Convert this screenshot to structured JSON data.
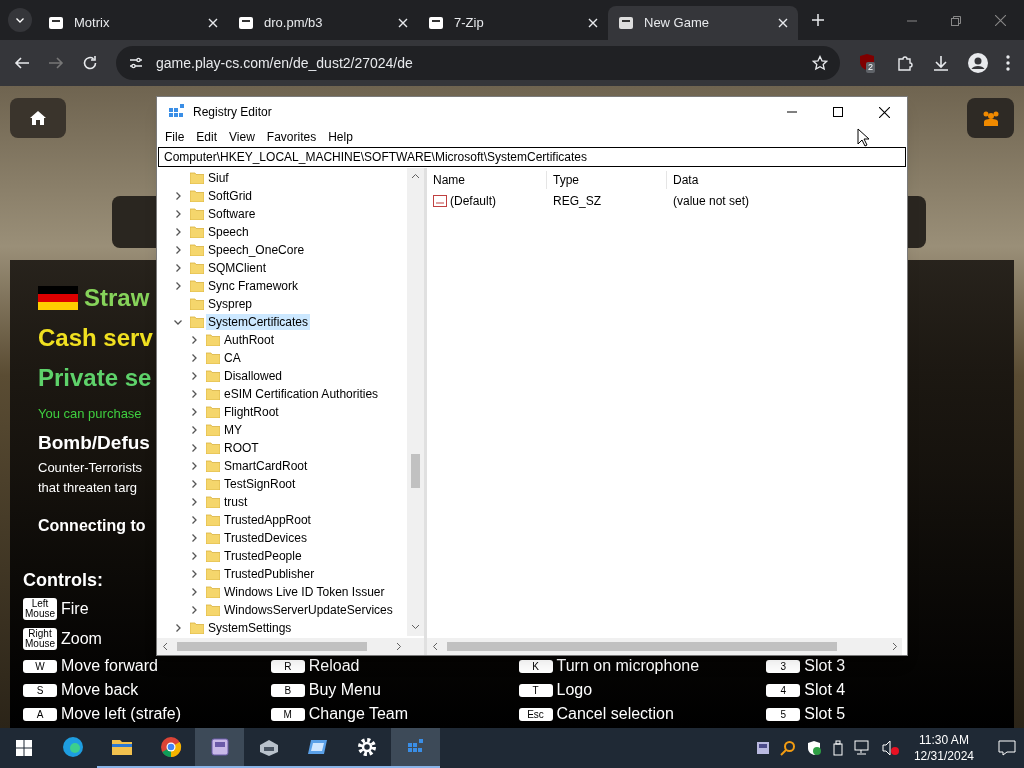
{
  "browser": {
    "tabs": [
      {
        "title": "Motrix",
        "selected": false
      },
      {
        "title": "dro.pm/b3",
        "selected": false
      },
      {
        "title": "7-Zip",
        "selected": false
      },
      {
        "title": "New Game",
        "selected": true
      }
    ],
    "url": "game.play-cs.com/en/de_dust2/27024/de",
    "extension_badge": "2"
  },
  "page": {
    "server_name": "Straw",
    "cash_line": "Cash serv",
    "private_line": "Private se",
    "purchase_note": "You can purchase",
    "mode_title": "Bomb/Defus",
    "mode_text": [
      "Counter-Terrorists",
      "that threaten targ"
    ],
    "status": "Connecting to",
    "controls_title": "Controls:",
    "controls": [
      [
        {
          "key": "Left Mouse",
          "action": "Fire"
        },
        {
          "key": "Right Mouse",
          "action": "Zoom"
        },
        {
          "key": "W",
          "action": "Move forward"
        },
        {
          "key": "S",
          "action": "Move back"
        },
        {
          "key": "A",
          "action": "Move left (strafe)"
        }
      ],
      [
        {
          "key": "R",
          "action": "Reload"
        },
        {
          "key": "B",
          "action": "Buy Menu"
        },
        {
          "key": "M",
          "action": "Change Team"
        }
      ],
      [
        {
          "key": "K",
          "action": "Turn on microphone"
        },
        {
          "key": "T",
          "action": "Logo"
        },
        {
          "key": "Esc",
          "action": "Cancel selection"
        }
      ],
      [
        {
          "key": "3",
          "action": "Slot 3"
        },
        {
          "key": "4",
          "action": "Slot 4"
        },
        {
          "key": "5",
          "action": "Slot 5"
        }
      ]
    ]
  },
  "registry": {
    "title": "Registry Editor",
    "menu": [
      "File",
      "Edit",
      "View",
      "Favorites",
      "Help"
    ],
    "address": "Computer\\HKEY_LOCAL_MACHINE\\SOFTWARE\\Microsoft\\SystemCertificates",
    "tree": [
      {
        "label": "Siuf",
        "expandable": false,
        "expanded": false,
        "selected": false
      },
      {
        "label": "SoftGrid",
        "expandable": true,
        "expanded": false,
        "selected": false
      },
      {
        "label": "Software",
        "expandable": true,
        "expanded": false,
        "selected": false
      },
      {
        "label": "Speech",
        "expandable": true,
        "expanded": false,
        "selected": false
      },
      {
        "label": "Speech_OneCore",
        "expandable": true,
        "expanded": false,
        "selected": false
      },
      {
        "label": "SQMClient",
        "expandable": true,
        "expanded": false,
        "selected": false
      },
      {
        "label": "Sync Framework",
        "expandable": true,
        "expanded": false,
        "selected": false
      },
      {
        "label": "Sysprep",
        "expandable": false,
        "expanded": false,
        "selected": false
      },
      {
        "label": "SystemCertificates",
        "expandable": true,
        "expanded": true,
        "selected": true,
        "children": [
          {
            "label": "AuthRoot",
            "expandable": true,
            "expanded": false,
            "selected": false
          },
          {
            "label": "CA",
            "expandable": true,
            "expanded": false,
            "selected": false
          },
          {
            "label": "Disallowed",
            "expandable": true,
            "expanded": false,
            "selected": false
          },
          {
            "label": "eSIM Certification Authorities",
            "expandable": true,
            "expanded": false,
            "selected": false
          },
          {
            "label": "FlightRoot",
            "expandable": true,
            "expanded": false,
            "selected": false
          },
          {
            "label": "MY",
            "expandable": true,
            "expanded": false,
            "selected": false
          },
          {
            "label": "ROOT",
            "expandable": true,
            "expanded": false,
            "selected": false
          },
          {
            "label": "SmartCardRoot",
            "expandable": true,
            "expanded": false,
            "selected": false
          },
          {
            "label": "TestSignRoot",
            "expandable": true,
            "expanded": false,
            "selected": false
          },
          {
            "label": "trust",
            "expandable": true,
            "expanded": false,
            "selected": false
          },
          {
            "label": "TrustedAppRoot",
            "expandable": true,
            "expanded": false,
            "selected": false
          },
          {
            "label": "TrustedDevices",
            "expandable": true,
            "expanded": false,
            "selected": false
          },
          {
            "label": "TrustedPeople",
            "expandable": true,
            "expanded": false,
            "selected": false
          },
          {
            "label": "TrustedPublisher",
            "expandable": true,
            "expanded": false,
            "selected": false
          },
          {
            "label": "Windows Live ID Token Issuer",
            "expandable": true,
            "expanded": false,
            "selected": false
          },
          {
            "label": "WindowsServerUpdateServices",
            "expandable": true,
            "expanded": false,
            "selected": false
          }
        ]
      },
      {
        "label": "SystemSettings",
        "expandable": true,
        "expanded": false,
        "selected": false
      }
    ],
    "columns": [
      "Name",
      "Type",
      "Data"
    ],
    "values": [
      {
        "name": "(Default)",
        "type": "REG_SZ",
        "data": "(value not set)"
      }
    ]
  },
  "taskbar": {
    "apps": [
      {
        "running": false,
        "selected": false
      },
      {
        "running": true,
        "selected": false
      },
      {
        "running": true,
        "selected": false
      },
      {
        "running": true,
        "selected": true
      },
      {
        "running": true,
        "selected": false
      },
      {
        "running": true,
        "selected": false
      },
      {
        "running": true,
        "selected": false
      },
      {
        "running": true,
        "selected": true
      }
    ],
    "time": "11:30 AM",
    "date": "12/31/2024"
  }
}
